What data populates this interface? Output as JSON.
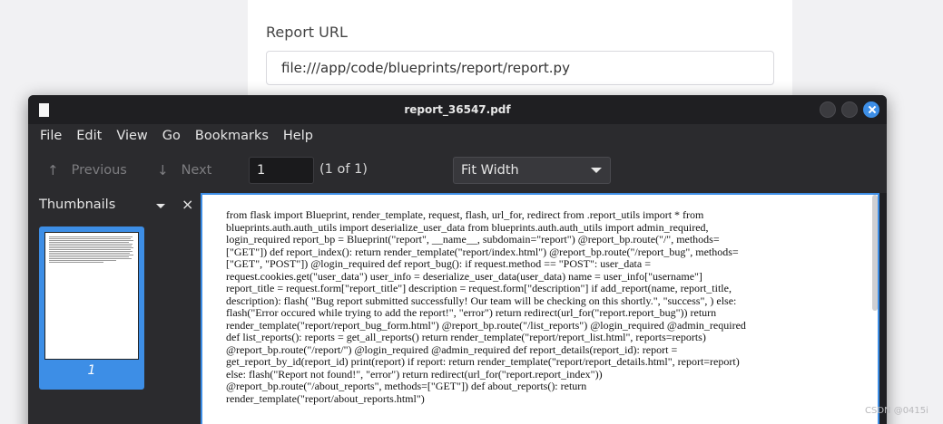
{
  "background_page": {
    "report_url_label": "Report URL",
    "report_url_value": "file:///app/code/blueprints/report/report.py"
  },
  "window": {
    "title": "report_36547.pdf"
  },
  "menu": {
    "items": [
      "File",
      "Edit",
      "View",
      "Go",
      "Bookmarks",
      "Help"
    ]
  },
  "toolbar": {
    "previous_label": "Previous",
    "next_label": "Next",
    "page_value": "1",
    "page_count": "(1 of 1)",
    "zoom_value": "Fit Width"
  },
  "sidebar": {
    "title": "Thumbnails",
    "close_glyph": "×",
    "thumbnail_number": "1"
  },
  "document": {
    "text": "from flask import Blueprint, render_template, request, flash, url_for, redirect from .report_utils import * from\nblueprints.auth.auth_utils import deserialize_user_data from blueprints.auth.auth_utils import admin_required,\nlogin_required report_bp = Blueprint(\"report\", __name__, subdomain=\"report\") @report_bp.route(\"/\", methods=\n[\"GET\"]) def report_index(): return render_template(\"report/index.html\") @report_bp.route(\"/report_bug\", methods=\n[\"GET\", \"POST\"]) @login_required def report_bug(): if request.method == \"POST\": user_data =\nrequest.cookies.get(\"user_data\") user_info = deserialize_user_data(user_data) name = user_info[\"username\"]\nreport_title = request.form[\"report_title\"] description = request.form[\"description\"] if add_report(name, report_title,\ndescription): flash( \"Bug report submitted successfully! Our team will be checking on this shortly.\", \"success\", ) else:\nflash(\"Error occured while trying to add the report!\", \"error\") return redirect(url_for(\"report.report_bug\")) return\nrender_template(\"report/report_bug_form.html\") @report_bp.route(\"/list_reports\") @login_required @admin_required\ndef list_reports(): reports = get_all_reports() return render_template(\"report/report_list.html\", reports=reports)\n@report_bp.route(\"/report/\") @login_required @admin_required def report_details(report_id): report =\nget_report_by_id(report_id) print(report) if report: return render_template(\"report/report_details.html\", report=report)\nelse: flash(\"Report not found!\", \"error\") return redirect(url_for(\"report.report_index\"))\n@report_bp.route(\"/about_reports\", methods=[\"GET\"]) def about_reports(): return\nrender_template(\"report/about_reports.html\")"
  },
  "watermark": "CSDN @0415i",
  "colors": {
    "accent": "#3d8ee6",
    "window_bg": "#2b2b2e",
    "titlebar_bg": "#1f1f22"
  }
}
